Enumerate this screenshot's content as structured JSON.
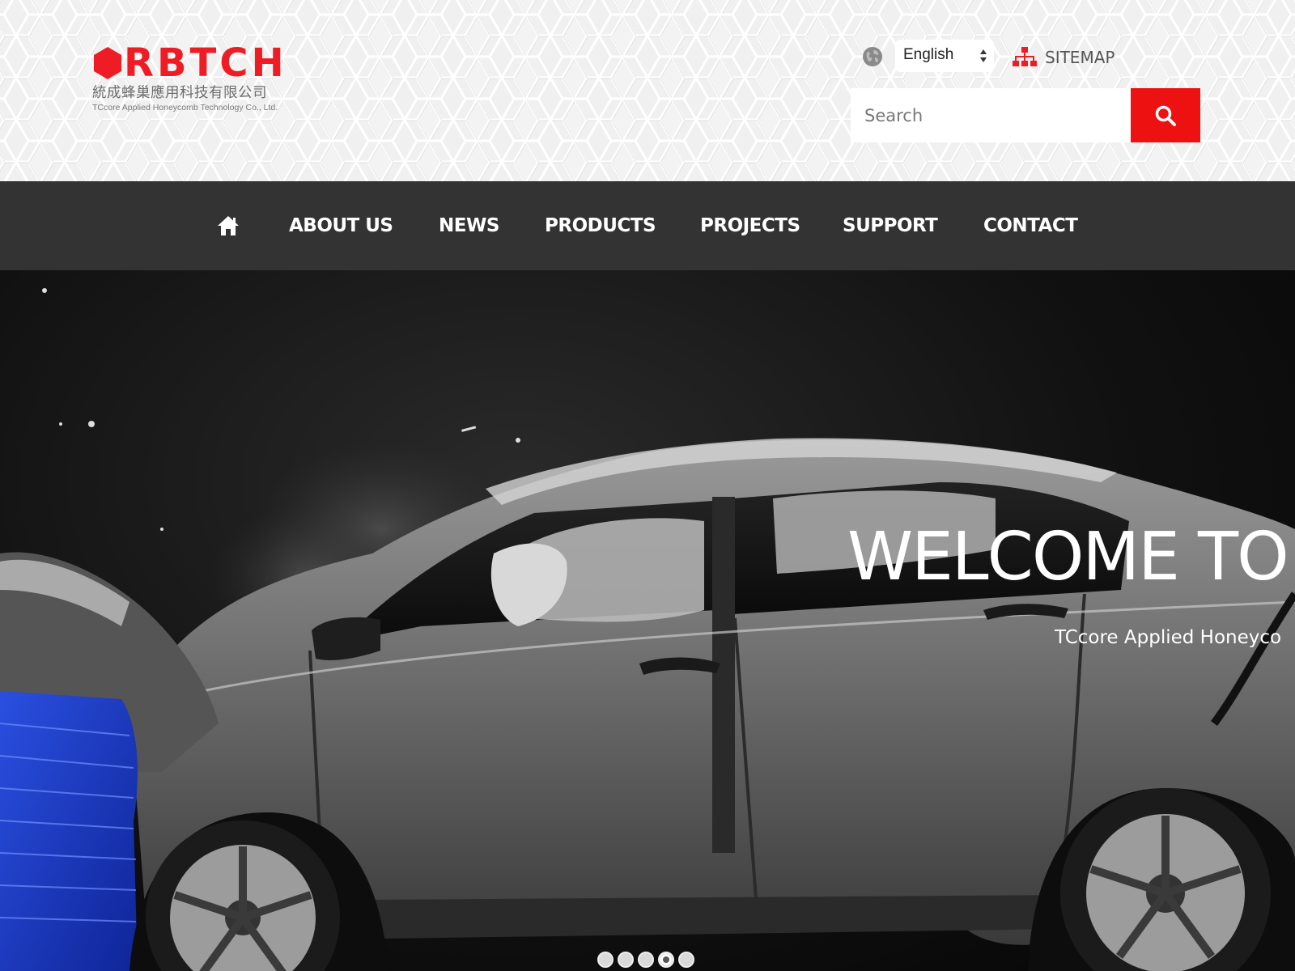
{
  "header": {
    "logo": {
      "wordmark": "RBTCH",
      "chinese_name": "統成蜂巢應用科技有限公司",
      "english_name": "TCcore Applied Honeycomb Technology Co., Ltd.",
      "brand_color": "#ee1c24"
    },
    "language": {
      "icon": "globe-icon",
      "selected": "English"
    },
    "sitemap": {
      "icon": "sitemap-icon",
      "label": "SITEMAP"
    },
    "search": {
      "placeholder": "Search",
      "value": "",
      "button_icon": "search-icon",
      "button_color": "#ee1111"
    }
  },
  "nav": {
    "home_icon": "home-icon",
    "items": [
      {
        "label": "ABOUT US"
      },
      {
        "label": "NEWS"
      },
      {
        "label": "PRODUCTS"
      },
      {
        "label": "PROJECTS"
      },
      {
        "label": "SUPPORT"
      },
      {
        "label": "CONTACT"
      }
    ],
    "background": "#333333"
  },
  "hero": {
    "title": "WELCOME TO",
    "subtitle": "TCcore Applied Honeyco",
    "slides_count": 5,
    "active_slide": 4
  }
}
